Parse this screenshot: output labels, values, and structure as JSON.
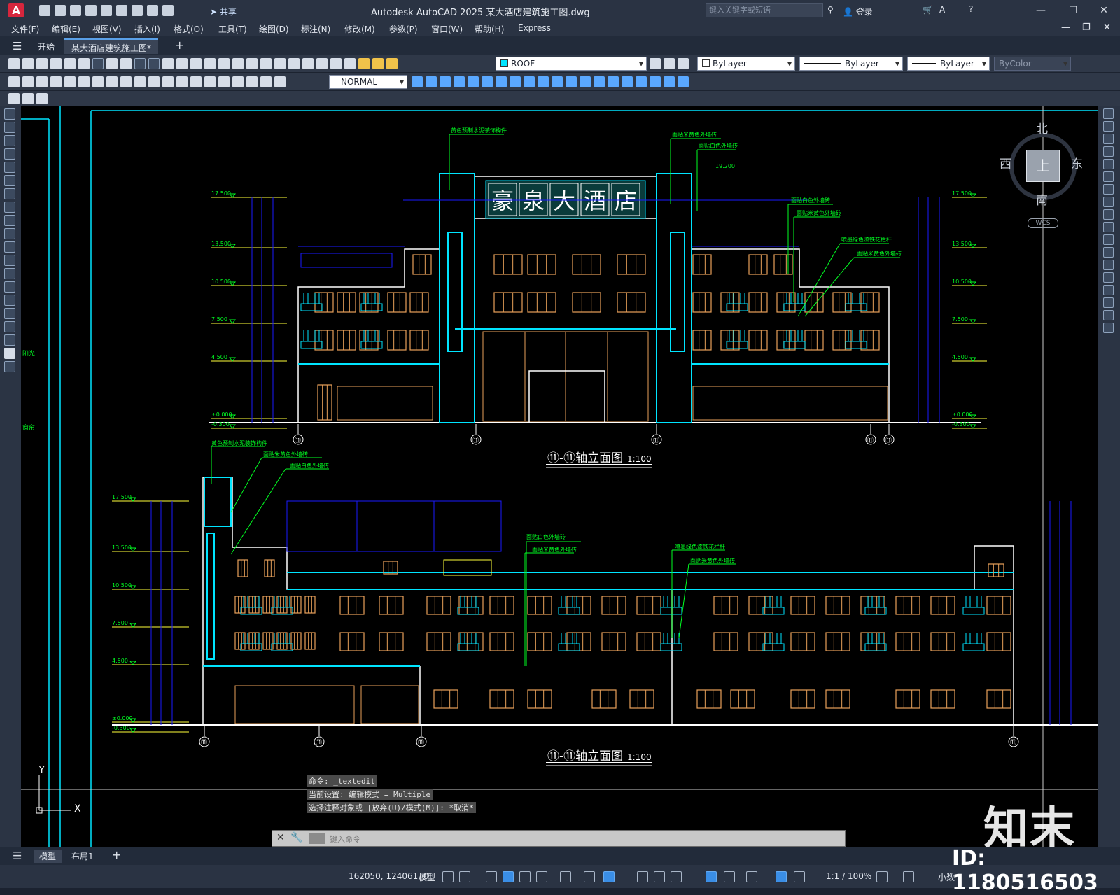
{
  "titlebar": {
    "logo": "A",
    "share": "共享",
    "title": "Autodesk AutoCAD 2025    某大酒店建筑施工图.dwg",
    "search_placeholder": "键入关键字或短语",
    "login": "登录",
    "minimize": "—",
    "maximize": "☐",
    "close": "✕"
  },
  "menubar": {
    "items": [
      "文件(F)",
      "编辑(E)",
      "视图(V)",
      "插入(I)",
      "格式(O)",
      "工具(T)",
      "绘图(D)",
      "标注(N)",
      "修改(M)",
      "参数(P)",
      "窗口(W)",
      "帮助(H)",
      "Express"
    ]
  },
  "tabs": {
    "start": "开始",
    "drawing": "某大酒店建筑施工图*",
    "add": "+"
  },
  "toolbar": {
    "layer": "ROOF",
    "dimstyle": "NORMAL",
    "color": "ByLayer",
    "linetype": "ByLayer",
    "lineweight": "ByLayer",
    "plotstyle": "ByColor"
  },
  "viewcube": {
    "north": "北",
    "south": "南",
    "east": "东",
    "west": "西",
    "top": "上",
    "wcs": "WCS"
  },
  "drawing": {
    "hotel_sign": [
      "豪",
      "泉",
      "大",
      "酒",
      "店"
    ],
    "front_title": "⑪-⑪轴立面图",
    "front_scale": "1:100",
    "side_title": "⑪-⑪轴立面图",
    "side_scale": "1:100",
    "front_elevations": [
      "17.500",
      "13.500",
      "10.500",
      "7.500",
      "4.500",
      "±0.000",
      "-0.300"
    ],
    "side_elevations": [
      "17.500",
      "13.500",
      "10.500",
      "7.500",
      "4.500",
      "±0.000",
      "-0.300"
    ],
    "top_elev": "19.200",
    "axis_bubble": "⑪",
    "front_notes": [
      "黄色预制水泥装饰构件",
      "面贴米黄色外墙砖",
      "面贴白色外墙砖",
      "面贴白色外墙砖",
      "面贴米黄色外墙砖",
      "喷墨绿色漆铁花栏杆",
      "面贴米黄色外墙砖"
    ],
    "side_notes": [
      "黄色预制水泥装饰构件",
      "面贴米黄色外墙砖",
      "面贴白色外墙砖",
      "面贴白色外墙砖",
      "面贴米黄色外墙砖",
      "喷墨绿色漆铁花栏杆",
      "面贴米黄色外墙砖"
    ],
    "left_label_1": "阳光",
    "left_label_2": "窗帘",
    "ucs_x": "X",
    "ucs_y": "Y"
  },
  "command": {
    "history": [
      "命令: _textedit",
      "当前设置: 编辑模式 = Multiple",
      "选择注释对象或 [放弃(U)/模式(M)]: *取消*"
    ],
    "placeholder": "键入命令"
  },
  "layout_tabs": {
    "model": "模型",
    "layout1": "布局1",
    "add": "+"
  },
  "status": {
    "coords": "162050, 124061, 0",
    "space": "模型",
    "scale": "1:1 / 100%",
    "units": "小数"
  },
  "watermark": {
    "logo": "知末",
    "id": "ID: 1180516503"
  },
  "colors": {
    "cyan": "#00e5ff",
    "blue": "#1a1aff",
    "orange": "#e8a15a",
    "green": "#00ff22",
    "yellow": "#ffff3a",
    "white": "#ffffff"
  }
}
